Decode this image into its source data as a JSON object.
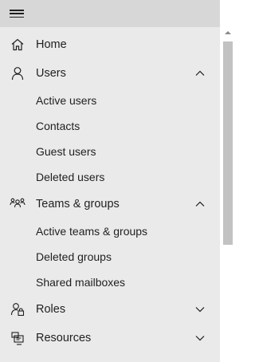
{
  "nav": {
    "items": [
      {
        "label": "Home",
        "icon": "home-icon",
        "expandable": false
      },
      {
        "label": "Users",
        "icon": "user-icon",
        "expandable": true,
        "expanded": true,
        "children": [
          "Active users",
          "Contacts",
          "Guest users",
          "Deleted users"
        ]
      },
      {
        "label": "Teams & groups",
        "icon": "teams-groups-icon",
        "expandable": true,
        "expanded": true,
        "children": [
          "Active teams & groups",
          "Deleted groups",
          "Shared mailboxes"
        ]
      },
      {
        "label": "Roles",
        "icon": "roles-icon",
        "expandable": true,
        "expanded": false
      },
      {
        "label": "Resources",
        "icon": "resources-icon",
        "expandable": true,
        "expanded": false
      }
    ]
  },
  "colors": {
    "panel_bg": "#eaeaea",
    "topbar_bg": "#d7d7d7",
    "text": "#201f1e",
    "scroll_thumb": "#c2c2c2"
  }
}
